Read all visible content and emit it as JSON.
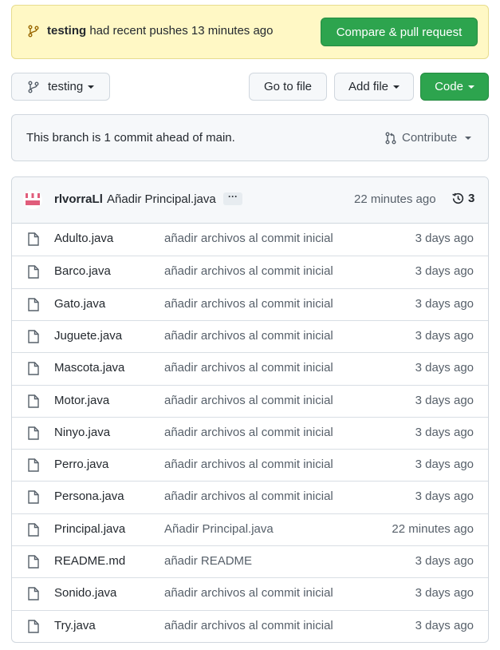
{
  "banner": {
    "branch": "testing",
    "message": " had recent pushes 13 minutes ago",
    "compare_label": "Compare & pull request"
  },
  "toolbar": {
    "branch_label": "testing",
    "go_to_file": "Go to file",
    "add_file": "Add file",
    "code": "Code"
  },
  "branch_status": {
    "text": "This branch is 1 commit ahead of main.",
    "contribute": "Contribute"
  },
  "latest_commit": {
    "author": "rlvorraLl",
    "message": "Añadir Principal.java",
    "ellipsis": "···",
    "time": "22 minutes ago",
    "commit_count": "3"
  },
  "files": [
    {
      "name": "Adulto.java",
      "message": "añadir archivos al commit inicial",
      "time": "3 days ago"
    },
    {
      "name": "Barco.java",
      "message": "añadir archivos al commit inicial",
      "time": "3 days ago"
    },
    {
      "name": "Gato.java",
      "message": "añadir archivos al commit inicial",
      "time": "3 days ago"
    },
    {
      "name": "Juguete.java",
      "message": "añadir archivos al commit inicial",
      "time": "3 days ago"
    },
    {
      "name": "Mascota.java",
      "message": "añadir archivos al commit inicial",
      "time": "3 days ago"
    },
    {
      "name": "Motor.java",
      "message": "añadir archivos al commit inicial",
      "time": "3 days ago"
    },
    {
      "name": "Ninyo.java",
      "message": "añadir archivos al commit inicial",
      "time": "3 days ago"
    },
    {
      "name": "Perro.java",
      "message": "añadir archivos al commit inicial",
      "time": "3 days ago"
    },
    {
      "name": "Persona.java",
      "message": "añadir archivos al commit inicial",
      "time": "3 days ago"
    },
    {
      "name": "Principal.java",
      "message": "Añadir Principal.java",
      "time": "22 minutes ago"
    },
    {
      "name": "README.md",
      "message": "añadir README",
      "time": "3 days ago"
    },
    {
      "name": "Sonido.java",
      "message": "añadir archivos al commit inicial",
      "time": "3 days ago"
    },
    {
      "name": "Try.java",
      "message": "añadir archivos al commit inicial",
      "time": "3 days ago"
    }
  ],
  "colors": {
    "banner_bg": "#fff8c5",
    "primary_green": "#2da44e",
    "avatar_accent": "#e05d7b"
  },
  "icons": {
    "branch": "git-branch-icon",
    "pull_request": "git-pull-request-icon",
    "history": "history-icon",
    "file": "file-icon"
  }
}
